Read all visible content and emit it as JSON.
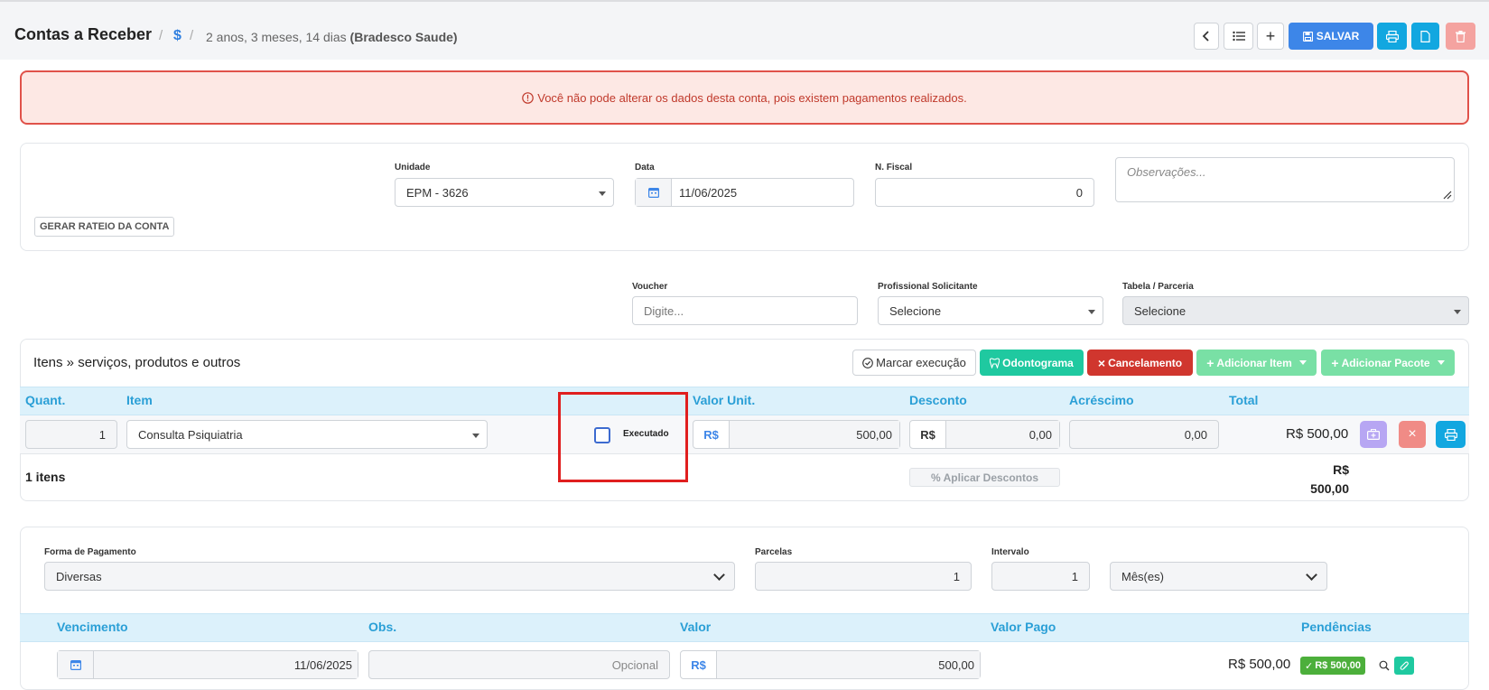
{
  "header": {
    "title": "Contas a Receber",
    "currency_symbol": "$",
    "duration": "2 anos, 3 meses, 14 dias",
    "patient": "(Bradesco Saude)",
    "save_label": "SALVAR"
  },
  "alert": {
    "text": "Você não pode alterar os dados desta conta, pois existem pagamentos realizados."
  },
  "account": {
    "rateio_label": "GERAR RATEIO DA CONTA",
    "unidade_label": "Unidade",
    "unidade_value": "EPM - 3626",
    "data_label": "Data",
    "data_value": "11/06/2025",
    "nfiscal_label": "N. Fiscal",
    "nfiscal_value": "0",
    "obs_placeholder": "Observações..."
  },
  "filters": {
    "voucher_label": "Voucher",
    "voucher_placeholder": "Digite...",
    "profissional_label": "Profissional Solicitante",
    "profissional_value": "Selecione",
    "tabela_label": "Tabela / Parceria",
    "tabela_value": "Selecione"
  },
  "items": {
    "heading": "Itens » serviços, produtos e outros",
    "buttons": {
      "marcar": "Marcar execução",
      "odontograma": "Odontograma",
      "cancelamento": "Cancelamento",
      "adicionar_item": "Adicionar Item",
      "adicionar_pacote": "Adicionar Pacote"
    },
    "columns": [
      "Quant.",
      "Item",
      "Valor Unit.",
      "Desconto",
      "Acréscimo",
      "Total"
    ],
    "row": {
      "quant": "1",
      "item": "Consulta Psiquiatria",
      "executado_label": "Executado",
      "executado_checked": false,
      "currency": "R$",
      "valor_unit": "500,00",
      "desconto": "0,00",
      "acrescimo": "0,00",
      "total": "R$ 500,00"
    },
    "footer": {
      "count": "1 itens",
      "aplicar": "Aplicar Descontos",
      "total_currency": "R$",
      "total_value": "500,00"
    }
  },
  "payment": {
    "forma_label": "Forma de Pagamento",
    "forma_value": "Diversas",
    "parcelas_label": "Parcelas",
    "parcelas_value": "1",
    "intervalo_label": "Intervalo",
    "intervalo_value": "1",
    "periodo_value": "Mês(es)",
    "columns": [
      "Vencimento",
      "Obs.",
      "Valor",
      "Valor Pago",
      "Pendências"
    ],
    "row": {
      "vencimento": "11/06/2025",
      "obs_placeholder": "Opcional",
      "currency": "R$",
      "valor": "500,00",
      "valor_pago": "R$ 500,00",
      "badge": "R$ 500,00"
    }
  },
  "colors": {
    "primary": "#2f7fe0",
    "teal": "#1fc9a0",
    "danger": "#d0362e",
    "success_light": "#79e0a5",
    "cyan": "#12a7e0",
    "header_bg": "#dcf1fb",
    "header_text": "#2a9fd6"
  }
}
